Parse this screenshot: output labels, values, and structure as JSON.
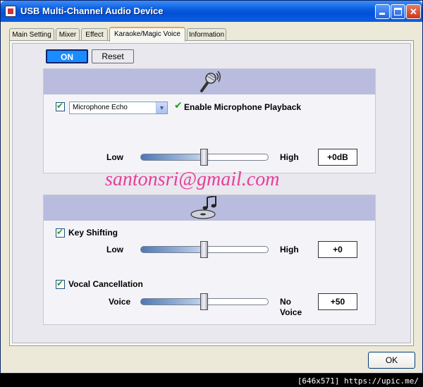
{
  "window": {
    "title": "USB Multi-Channel Audio Device",
    "title_controls": [
      "minimize",
      "maximize",
      "close"
    ],
    "accent_color": "#0a5ee0"
  },
  "tabs": [
    {
      "label": "Main Setting"
    },
    {
      "label": "Mixer"
    },
    {
      "label": "Effect"
    },
    {
      "label": "Karaoke/Magic Voice",
      "active": true
    },
    {
      "label": "Information"
    }
  ],
  "toolbar": {
    "on_label": "ON",
    "reset_label": "Reset",
    "on_color": "#1a8cff"
  },
  "microphone": {
    "header_icon": "microphone-icon",
    "checkbox_checked": true,
    "effect_value": "Microphone Echo",
    "playback_label": "Enable Microphone Playback",
    "slider": {
      "low_label": "Low",
      "high_label": "High",
      "value": "+0dB",
      "position": 0.5
    }
  },
  "watermark": "santonsri@gmail.com",
  "music": {
    "header_icon": "music-note-cd-icon",
    "key_shifting": {
      "checked": true,
      "label": "Key Shifting",
      "low_label": "Low",
      "high_label": "High",
      "value": "+0",
      "position": 0.5
    },
    "vocal_cancellation": {
      "checked": true,
      "label": "Vocal Cancellation",
      "low_label": "Voice",
      "high_label_1": "No",
      "high_label_2": "Voice",
      "value": "+50",
      "position": 0.5
    }
  },
  "ok_label": "OK",
  "footer": "[646x571] https://upic.me/"
}
